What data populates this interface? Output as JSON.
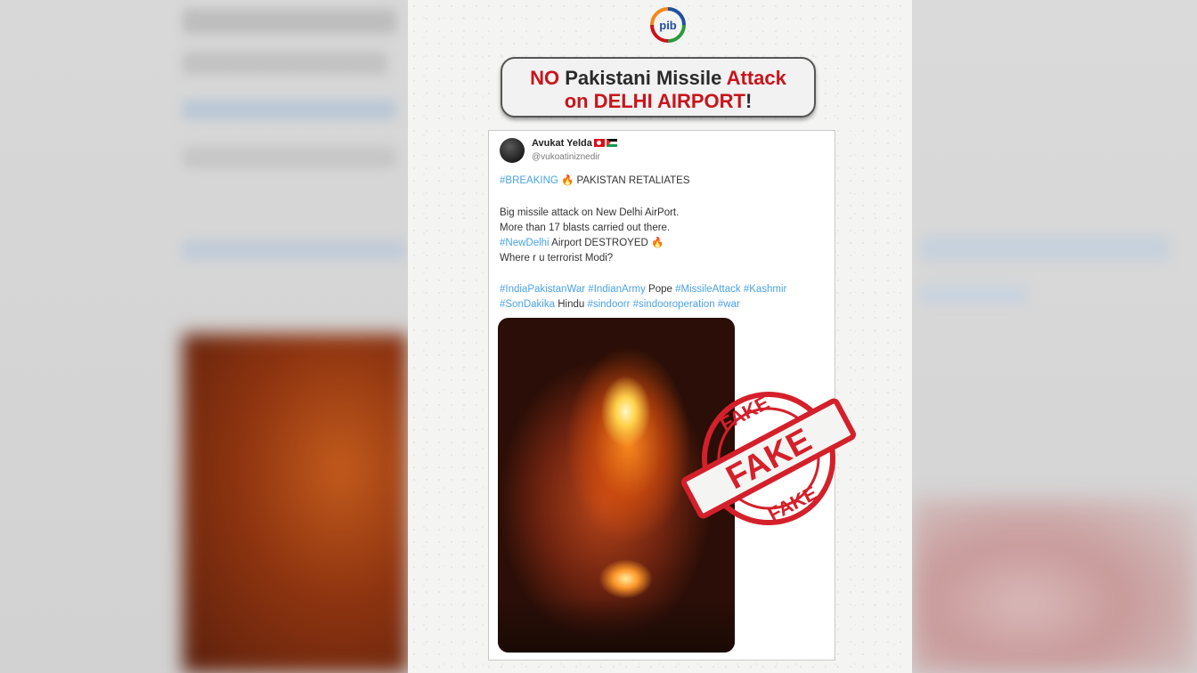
{
  "headline": {
    "prefix_red": "NO",
    "middle": " Pakistani Missile ",
    "attack_red": "Attack",
    "line2_start": "on DELHI AIRPORT",
    "line2_end": "!"
  },
  "tweet": {
    "user_name": "Avukat Yelda",
    "user_handle": "@vukoatiniznedir",
    "breaking_tag": "#BREAKING",
    "breaking_text": " PAKISTAN RETALIATES",
    "line1": "Big missile attack on New Delhi AirPort.",
    "line2": "More than 17 blasts carried out there.",
    "line3_tag": "#NewDelhi",
    "line3_text": " Airport DESTROYED ",
    "line4": "Where r u terrorist Modi?",
    "hashtags_1": [
      "#IndiaPakistanWar",
      "#IndianArmy"
    ],
    "plain_1": " Pope ",
    "hashtags_2": [
      "#MissileAttack",
      "#Kashmir"
    ],
    "hashtags_3": [
      "#SonDakika"
    ],
    "plain_2": " Hindu ",
    "hashtags_4": [
      "#sindoorr",
      "#sindooroperation",
      "#war"
    ]
  },
  "stamp": {
    "ring_top": "FAKE",
    "center": "FAKE",
    "ring_bottom": "FAKE"
  },
  "logo": {
    "text": "pib"
  },
  "colors": {
    "accent_red": "#c8141c",
    "hashtag_blue": "#4aa3e8",
    "stamp_red": "#d4202a"
  },
  "icons": [
    "pib-logo-icon",
    "fire-emoji-icon",
    "turkey-flag-icon",
    "palestine-flag-icon",
    "fake-stamp-icon"
  ]
}
